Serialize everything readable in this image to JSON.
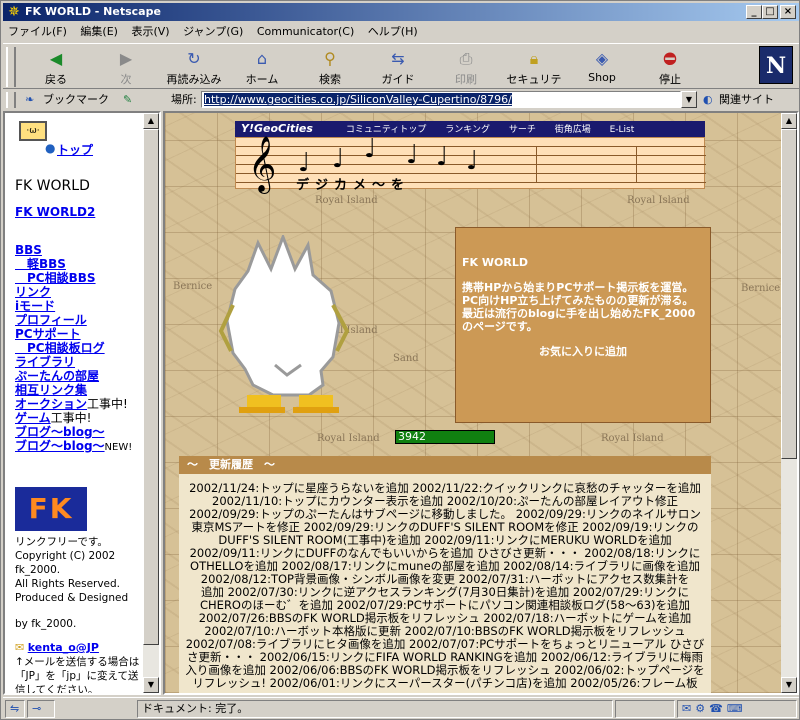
{
  "window": {
    "title": "FK WORLD - Netscape",
    "controls": {
      "minimize": "_",
      "maximize": "□",
      "close": "×"
    }
  },
  "menu": [
    "ファイル(F)",
    "編集(E)",
    "表示(V)",
    "ジャンプ(G)",
    "Communicator(C)",
    "ヘルプ(H)"
  ],
  "toolbar": {
    "back": "戻る",
    "forward": "次",
    "reload": "再読み込み",
    "home": "ホーム",
    "search": "検索",
    "guide": "ガイド",
    "print": "印刷",
    "security": "セキュリティ",
    "shop": "Shop",
    "stop": "停止",
    "logo": "N"
  },
  "location": {
    "bookmarks": "ブックマーク",
    "label": "場所:",
    "url": "http://www.geocities.co.jp/SiliconValley-Cupertino/8796/",
    "related": "関連サイト"
  },
  "left": {
    "top_link": "トップ",
    "site_title": "FK WORLD",
    "world2": "FK WORLD2",
    "nav": [
      "BBS",
      "　軽BBS",
      "　PC相談BBS",
      "リンク",
      "iモード",
      "プロフィール",
      "PCサポート",
      "　PC相談板ログ",
      "ライブラリ",
      "ぷーたんの部屋",
      "相互リンク集",
      "オークション",
      "ゲーム",
      "ブログ～blog～",
      "ブログ～blog～"
    ],
    "nav_suffix": {
      "auction": "工事中!",
      "game": "工事中!",
      "blog2": "NEW!"
    },
    "logo_text": "FK",
    "copyright": [
      "リンクフリーです。",
      "Copyright (C) 2002",
      "fk_2000.",
      "All Rights Reserved.",
      "Produced & Designed",
      "",
      "by fk_2000."
    ],
    "mail_link": "kenta_o@JP",
    "mail_note": "↑メールを送信する場合は「JP」を「jp」に変えて送信してください。"
  },
  "main": {
    "geo_logo": "Y!GeoCities",
    "geo_links": [
      "コミュニティトップ",
      "ランキング",
      "サーチ",
      "街角広場",
      "E-List"
    ],
    "banner_kana": "デジカメ～を",
    "map_labels": [
      "Royal Island",
      "Royal Island",
      "Royal Island",
      "Bernice",
      "Bernice",
      "Sand",
      "Royal Island",
      "Royal Island"
    ],
    "info": {
      "title": "FK WORLD",
      "body1": "携帯HPから始まりPCサポート掲示板を運営。",
      "body2": "PC向けHP立ち上げてみたものの更新が滞る。",
      "body3": "最近は流行のblogに手を出し始めたFK_2000のページです。",
      "favorite": "お気に入りに追加"
    },
    "counter": "3942",
    "news_title": "～　更新履歴　～",
    "news_lines": [
      "2002/11/24:トップに星座うらないを追加 2002/11/22:クイックリンクに哀愁のチャッターを追加",
      "2002/11/10:トップにカウンター表示を追加 2002/10/20:ぷーたんの部屋レイアウト修正",
      "2002/09/29:トップのぷーたんはサブページに移動しました。 2002/09/29:リンクのネイルサロン",
      "東京MSアートを修正 2002/09/29:リンクのDUFF'S SILENT ROOMを修正 2002/09/19:リンクの",
      "DUFF'S SILENT ROOM(工事中)を追加 2002/09/11:リンクにMERUKU WORLDを追加",
      "2002/09/11:リンクにDUFFのなんでもいいからを追加 ひさびさ更新・・・ 2002/08/18:リンクに",
      "OTHELLOを追加 2002/08/17:リンクにmuneの部屋を追加 2002/08/14:ライブラリに画像を追加",
      "2002/08/12:TOP背景画像・シンボル画像を変更 2002/07/31:ハーボットにアクセス数集計を",
      "追加 2002/07/30:リンクに逆アクセスランキング(7月30日集計)を追加 2002/07/29:リンクに",
      "CHEROのほーむ゛を追加 2002/07/29:PCサポートにパソコン関連相談板ログ(58～63)を追加",
      "2002/07/26:BBSのFK WORLD掲示板をリフレッシュ 2002/07/18:ハーボットにゲームを追加",
      "2002/07/10:ハーボット本格版に更新 2002/07/10:BBSのFK WORLD掲示板をリフレッシュ",
      "2002/07/08:ライブラリにヒタ画像を追加 2002/07/07:PCサポートをちょっとリニューアル ひさびさ更新・・・ 2002/06/15:リンクにFIFA WORLD RANKINGを追加 2002/06/12:ライブラリに梅雨入り画像を追加 2002/06/06:BBSのFK WORLD掲示板をリフレッシュ 2002/06/02:トップページをリフレッシュ! 2002/06/01:リンクにスーパースター(パチンコ店)を追加 2002/05/26:フレーム板"
    ]
  },
  "status": {
    "text": "ドキュメント: 完了。"
  }
}
